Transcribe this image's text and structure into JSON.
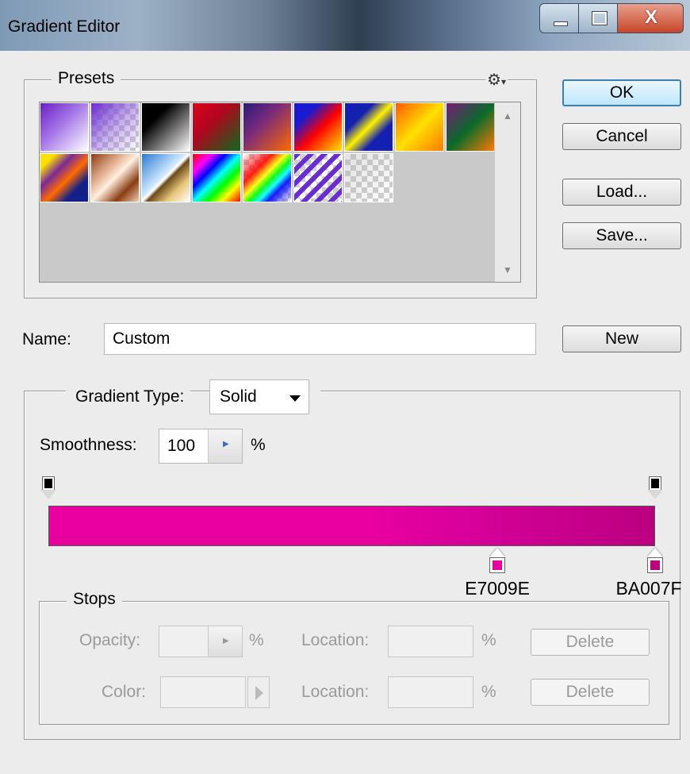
{
  "window": {
    "title": "Gradient Editor",
    "min_icon": "minimize-icon",
    "max_icon": "maximize-icon",
    "close_icon": "close-icon",
    "close_glyph": "X"
  },
  "presets": {
    "legend": "Presets",
    "menu_icon": "gear-icon",
    "menu_glyph": "⚙",
    "swatches": [
      {
        "name": "violet-to-white",
        "css": "linear-gradient(135deg,#6a1fc2 0%,#a678e6 45%,#ffffff 100%)"
      },
      {
        "name": "violet-to-transparent",
        "css": "linear-gradient(135deg,#6a2bd0 0%,rgba(140,90,220,0.5) 50%,rgba(255,255,255,0) 100%)",
        "checker": true
      },
      {
        "name": "black-to-white",
        "css": "linear-gradient(135deg,#000 0%,#000 30%,#fff 100%)"
      },
      {
        "name": "red-to-green",
        "css": "linear-gradient(135deg,#e0001b 0%,#b0061f 40%,#0a6b1a 100%)"
      },
      {
        "name": "violet-to-orange",
        "css": "linear-gradient(135deg,#2a1a7a 0%,#7a2a7a 40%,#ff6a00 100%)"
      },
      {
        "name": "blue-red-yellow",
        "css": "linear-gradient(135deg,#1a1ad0 0%,#1a1ad0 25%,#ff0000 55%,#ffe600 100%)"
      },
      {
        "name": "blue-yellow-blue",
        "css": "linear-gradient(135deg,#1420b0 0%,#1420b0 30%,#fff200 50%,#1420b0 70%,#1420b0 100%)"
      },
      {
        "name": "orange-yellow-orange",
        "css": "linear-gradient(135deg,#ff5a00 0%,#ffe000 50%,#ff7a00 100%)"
      },
      {
        "name": "violet-green-orange",
        "css": "linear-gradient(135deg,#7a1a7a 0%,#0a6a2a 50%,#ff7a00 100%)"
      },
      {
        "name": "yellow-violet-orange-blue",
        "css": "linear-gradient(135deg,#ffe000 0%,#ffe000 15%,#7a2a9a 35%,#ff6a00 55%,#14208a 75%,#14208a 100%)"
      },
      {
        "name": "copper",
        "css": "linear-gradient(135deg,#8a3c12 0%,#e8b89a 35%,#fff0e0 50%,#8a3c12 75%,#f2cbb0 100%)"
      },
      {
        "name": "chrome",
        "css": "linear-gradient(135deg,#2a7ad0 0%,#cfe8ff 45%,#ffffff 50%,#6a4a1a 55%,#e8c67a 75%,#ffffff 100%)"
      },
      {
        "name": "spectrum",
        "css": "linear-gradient(135deg,#ff0000 0%,#ff00ff 20%,#0000ff 35%,#00ffff 50%,#00ff00 65%,#ffff00 80%,#ff0000 100%)"
      },
      {
        "name": "transparent-rainbow",
        "css": "linear-gradient(135deg,rgba(255,255,255,0) 0%,rgba(255,0,0,0.9) 30%,rgba(255,255,0,0.9) 45%,rgba(0,255,0,0.9) 55%,rgba(0,255,255,0.9) 65%,rgba(0,0,255,0.9) 75%,rgba(255,255,255,0) 100%)",
        "checker": true
      },
      {
        "name": "transparent-stripes",
        "css": "repeating-linear-gradient(135deg,#6a2bd0 0px,#6a2bd0 6px,rgba(255,255,255,0) 6px,rgba(255,255,255,0) 12px)",
        "checker": true
      },
      {
        "name": "neutral-density",
        "css": "linear-gradient(135deg,rgba(170,170,170,0.35),rgba(255,255,255,0))",
        "checker": true
      }
    ]
  },
  "buttons": {
    "ok": "OK",
    "cancel": "Cancel",
    "load": "Load...",
    "save": "Save...",
    "new": "New"
  },
  "name_row": {
    "label": "Name:",
    "value": "Custom"
  },
  "gradient": {
    "type_label": "Gradient Type:",
    "type_value": "Solid",
    "smoothness_label": "Smoothness:",
    "smoothness_value": "100",
    "smoothness_unit": "%",
    "bar_css": "linear-gradient(90deg,#E7009E 0%,#E7009E 55%,#D60099 70%,#BA007F 100%)",
    "opacity_stops": [
      {
        "location": 0,
        "color": "#000000"
      },
      {
        "location": 100,
        "color": "#000000"
      }
    ],
    "color_stops": [
      {
        "location": 74,
        "hex": "E7009E",
        "color": "#E7009E"
      },
      {
        "location": 100,
        "hex": "BA007F",
        "color": "#BA007F"
      }
    ]
  },
  "stops": {
    "legend": "Stops",
    "opacity_label": "Opacity:",
    "opacity_unit": "%",
    "location_label": "Location:",
    "location_unit": "%",
    "delete": "Delete",
    "color_label": "Color:",
    "color_location_label": "Location:",
    "color_location_unit": "%",
    "color_delete": "Delete"
  }
}
